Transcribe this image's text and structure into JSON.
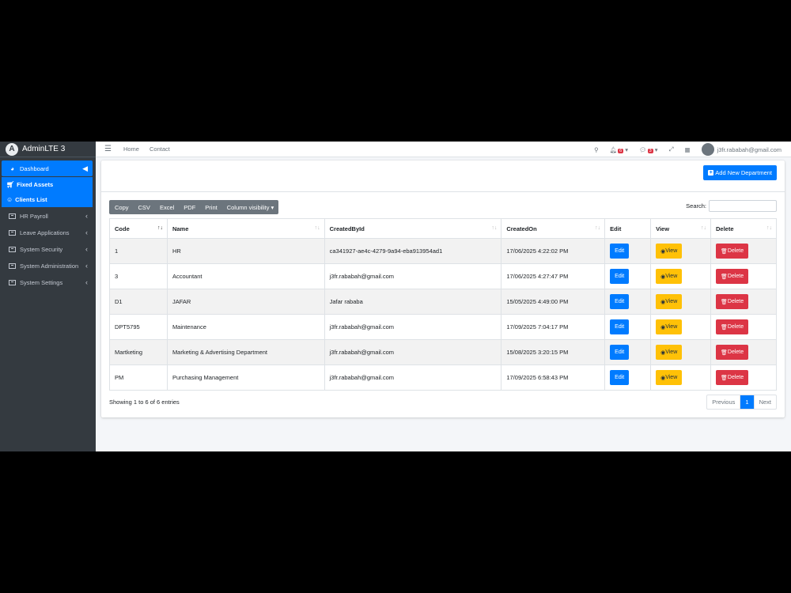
{
  "brand": {
    "name": "AdminLTE 3"
  },
  "sidebar": {
    "items": [
      {
        "label": "Dashboard",
        "active": true
      },
      {
        "label": "Fixed Assets"
      },
      {
        "label": "Clients List"
      },
      {
        "label": "HR Payroll"
      },
      {
        "label": "Leave Applications"
      },
      {
        "label": "System Security"
      },
      {
        "label": "System Administration"
      },
      {
        "label": "System Settings"
      }
    ]
  },
  "topbar": {
    "links": [
      "Home",
      "Contact"
    ],
    "notifications_count": "6",
    "messages_count": "3",
    "user_email": "j3fr.rababah@gmail.com"
  },
  "page": {
    "add_button_label": "Add New Department"
  },
  "table_tools": {
    "buttons": [
      "Copy",
      "CSV",
      "Excel",
      "PDF",
      "Print",
      "Column visibility ▾"
    ],
    "search_label": "Search:"
  },
  "table": {
    "columns": [
      "Code",
      "Name",
      "CreatedById",
      "CreatedOn",
      "Edit",
      "View",
      "Delete"
    ],
    "rows": [
      {
        "code": "1",
        "name": "HR",
        "created_by": "ca341927-ae4c-4279-9a94-eba913954ad1",
        "created_on": "17/06/2025 4:22:02 PM"
      },
      {
        "code": "3",
        "name": "Accountant",
        "created_by": "j3fr.rababah@gmail.com",
        "created_on": "17/06/2025 4:27:47 PM"
      },
      {
        "code": "D1",
        "name": "JAFAR",
        "created_by": "Jafar rababa",
        "created_on": "15/05/2025 4:49:00 PM"
      },
      {
        "code": "DPT5795",
        "name": "Maintenance",
        "created_by": "j3fr.rababah@gmail.com",
        "created_on": "17/09/2025 7:04:17 PM"
      },
      {
        "code": "Martketing",
        "name": "Marketing & Advertising Department",
        "created_by": "j3fr.rababah@gmail.com",
        "created_on": "15/08/2025 3:20:15 PM"
      },
      {
        "code": "PM",
        "name": "Purchasing Management",
        "created_by": "j3fr.rababah@gmail.com",
        "created_on": "17/09/2025 6:58:43 PM"
      }
    ],
    "edit_label": "Edit",
    "view_label": "View",
    "delete_label": "Delete"
  },
  "footer": {
    "info": "Showing 1 to 6 of 6 entries",
    "pagination": [
      "Previous",
      "1",
      "Next"
    ]
  },
  "colors": {
    "primary": "#007bff",
    "warning": "#ffc107",
    "danger": "#dc3545",
    "sidebar": "#343a40"
  }
}
